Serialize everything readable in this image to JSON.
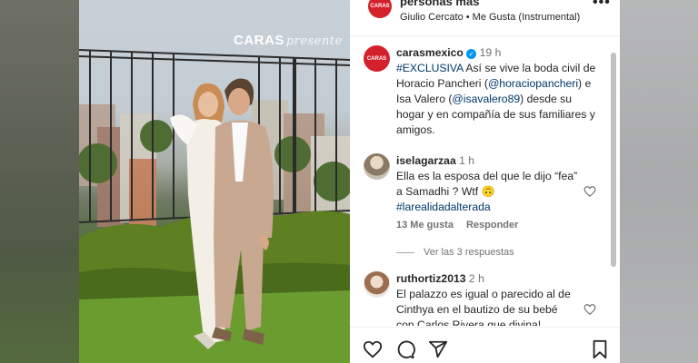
{
  "post_header": {
    "account": "personas más",
    "avatar_text": "CARAS",
    "audio": "Giulio Cercato • Me Gusta (Instrumental)",
    "more_icon": "more-horizontal-icon"
  },
  "photo": {
    "watermark_brand": "CARAS",
    "watermark_word": "presente"
  },
  "caption": {
    "avatar_text": "CARAS",
    "username": "carasmexico",
    "time": "19 h",
    "hashtag": "#EXCLUSIVA",
    "text_1": " Así se vive la boda civil de Horacio Pancheri (",
    "mention_1": "@horaciopancheri",
    "text_2": ") e Isa Valero (",
    "mention_2": "@isavalero89",
    "text_3": ") desde su hogar y en compañía de sus familiares y amigos."
  },
  "comments": [
    {
      "username": "iselagarzaa",
      "time": "1 h",
      "text": "Ella es la esposa del que le dijo “fea” a Samadhi ? Wtf 🙃",
      "hashtag": "#larealidadalterada",
      "likes": "13 Me gusta",
      "reply": "Responder",
      "view_replies": "Ver las 3 respuestas"
    },
    {
      "username": "ruthortiz2013",
      "time": "2 h",
      "text": "El palazzo es igual o parecido al de Cinthya en el bautizo de su bebé con Carlos Rivera que divina!"
    }
  ],
  "actions": [
    "heart-icon",
    "comment-icon",
    "share-icon",
    "bookmark-icon"
  ],
  "colors": {
    "brand": "#d3202a",
    "link": "#00376b",
    "verified": "#0095f6",
    "muted": "#737373",
    "text": "#262626"
  }
}
